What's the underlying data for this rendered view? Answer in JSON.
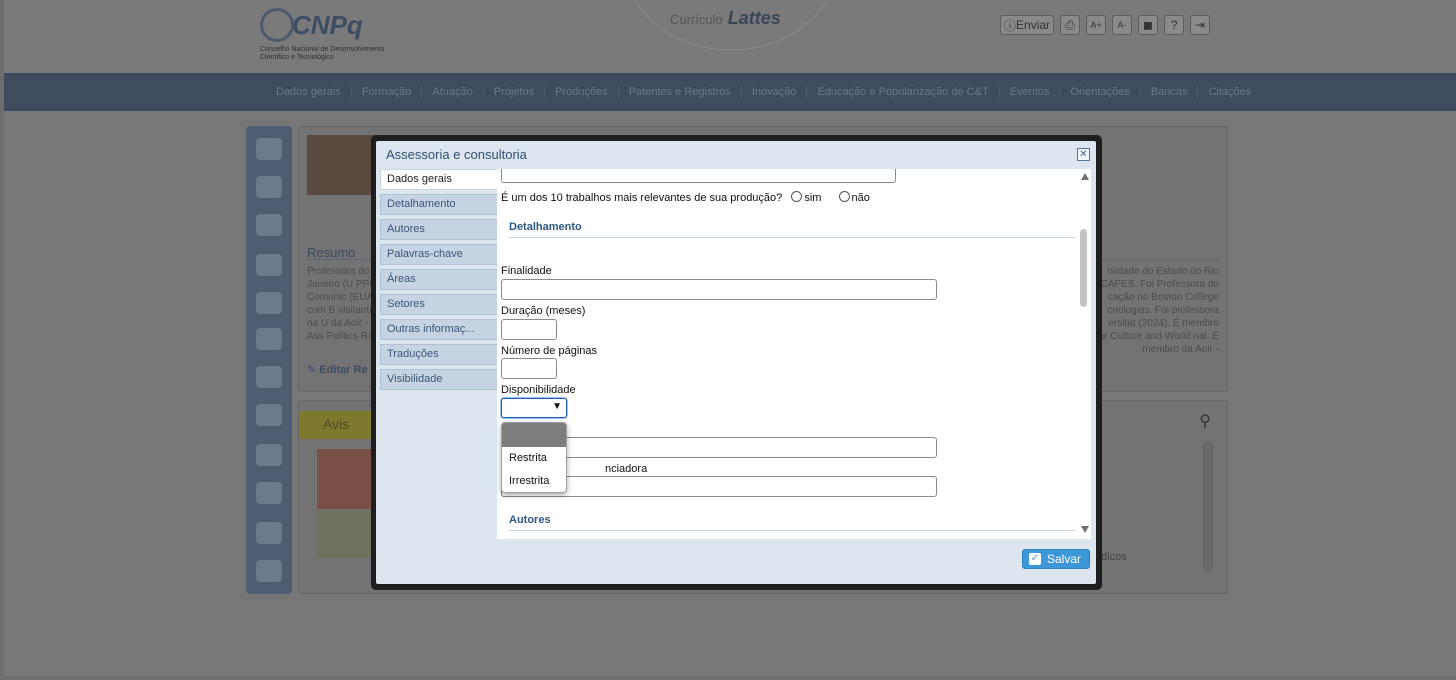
{
  "header": {
    "logo_text": "CNPq",
    "logo_subtitle": "Conselho Nacional de Desenvolvimento Científico e Tecnológico",
    "lattes_small": "Currículo",
    "lattes_big": "Lattes",
    "tools": {
      "enviar": "Enviar",
      "print_glyph": "⎙",
      "font_inc_glyph": "A+",
      "font_dec_glyph": "A-",
      "contrast_glyph": "◼",
      "help_glyph": "?",
      "exit_glyph": "⇥"
    }
  },
  "nav": {
    "items": [
      "Dados gerais",
      "Formação",
      "Atuação",
      "Projetos",
      "Produções",
      "Patentes e Registros",
      "Inovação",
      "Educação e Popularização de C&T",
      "Eventos",
      "Orientações",
      "Bancas",
      "Citações"
    ]
  },
  "background": {
    "resumo_title": "Resumo",
    "resumo_left": "Professora do Janeiro (U PPG Comunic (EUA) com B visitante na U da Aoir - Ass Politics Rook",
    "resumo_right": "rsidade do Estado do Rio CAPES. Foi Professora do cação no Boston College cnologias. Foi professora ersität (2024). É membro opular Culture and World nal. É membro da Aoir -",
    "editar": "Editar Re",
    "aviso": "Avis",
    "periodicos": "ódicos"
  },
  "modal": {
    "title": "Assessoria e consultoria",
    "close_glyph": "✕",
    "tabs": [
      "Dados gerais",
      "Detalhamento",
      "Autores",
      "Palavras-chave",
      "Áreas",
      "Setores",
      "Outras informaç...",
      "Traduções",
      "Visibilidade"
    ],
    "relevant_question": "É um dos 10 trabalhos mais relevantes de sua produção?",
    "relevant_options": {
      "yes": "sim",
      "no": "não"
    },
    "section_detalhamento": "Detalhamento",
    "fields": {
      "finalidade": "Finalidade",
      "duracao": "Duração (meses)",
      "paginas": "Número de páginas",
      "disponibilidade": "Disponibilidade",
      "financiadora_partial": "nciadora"
    },
    "select_value": "",
    "dropdown_options": [
      "Restrita",
      "Irrestrita"
    ],
    "section_autores": "Autores",
    "save_label": "Salvar",
    "save_check": "✓"
  }
}
